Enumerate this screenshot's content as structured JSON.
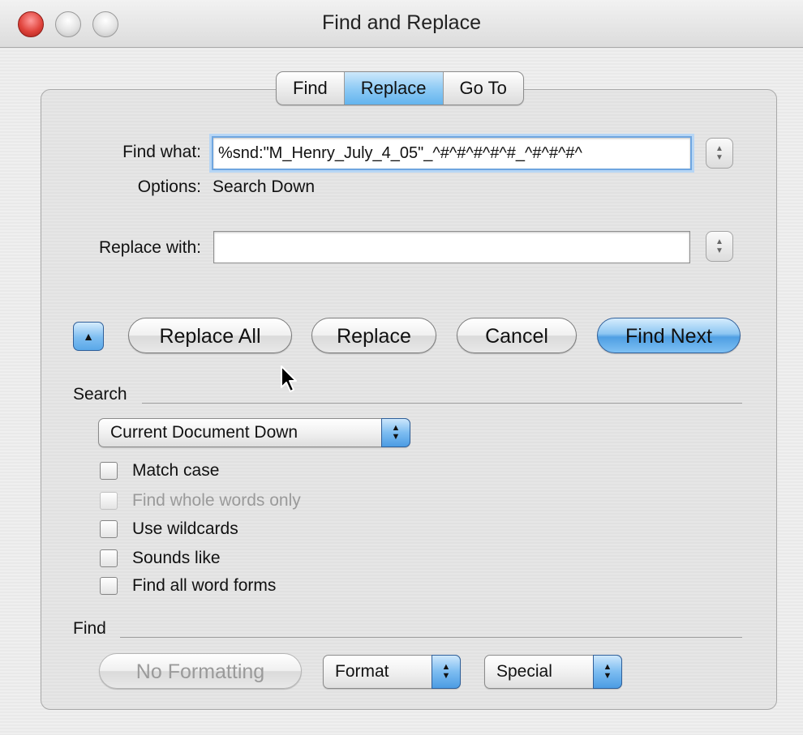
{
  "window": {
    "title": "Find and Replace"
  },
  "tabs": [
    {
      "label": "Find",
      "active": false
    },
    {
      "label": "Replace",
      "active": true
    },
    {
      "label": "Go To",
      "active": false
    }
  ],
  "find": {
    "label": "Find what:",
    "value": "%snd:\"M_Henry_July_4_05\"_^#^#^#^#^#_^#^#^#^"
  },
  "options": {
    "label": "Options:",
    "value": "Search Down"
  },
  "replace": {
    "label": "Replace with:",
    "value": ""
  },
  "buttons": {
    "replace_all": "Replace All",
    "replace": "Replace",
    "cancel": "Cancel",
    "find_next": "Find Next"
  },
  "search": {
    "title": "Search",
    "scope": "Current Document Down",
    "checkboxes": [
      {
        "label": "Match case",
        "checked": false,
        "disabled": false
      },
      {
        "label": "Find whole words only",
        "checked": false,
        "disabled": true
      },
      {
        "label": "Use wildcards",
        "checked": false,
        "disabled": false
      },
      {
        "label": "Sounds like",
        "checked": false,
        "disabled": false
      },
      {
        "label": "Find all word forms",
        "checked": false,
        "disabled": false
      }
    ]
  },
  "find_section": {
    "title": "Find",
    "no_formatting": "No Formatting",
    "format": "Format",
    "special": "Special"
  },
  "colors": {
    "accent": "#63b4ee",
    "default_button": "#4f9fe3",
    "close_button": "#e0443c"
  }
}
